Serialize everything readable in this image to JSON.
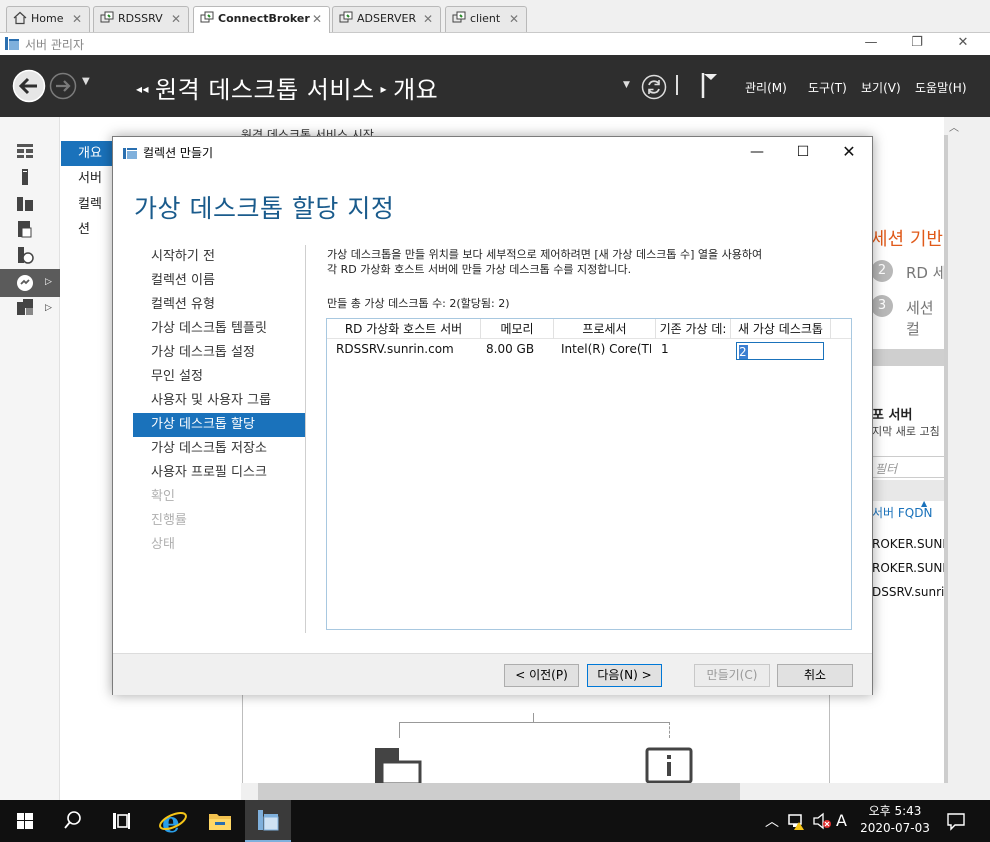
{
  "tabs": [
    {
      "label": "Home"
    },
    {
      "label": "RDSSRV"
    },
    {
      "label": "ConnectBroker"
    },
    {
      "label": "ADSERVER"
    },
    {
      "label": "client"
    }
  ],
  "server_manager": {
    "title": "서버 관리자",
    "breadcrumb": [
      "원격 데스크톱 서비스",
      "개요"
    ],
    "menus": [
      "관리(M)",
      "도구(T)",
      "보기(V)",
      "도움말(H)"
    ],
    "subnav": [
      "개요",
      "서버",
      "컬렉션"
    ],
    "content_peek": {
      "top_text": "원격 데스크톱 서비스 시작",
      "session_title": "세션 기반",
      "steps": [
        {
          "num": "2",
          "text": "RD 세"
        },
        {
          "num": "3",
          "text": "세션 컬"
        }
      ],
      "deploy_title": "포 서버",
      "deploy_sub": "지막 새로 고침",
      "filter_placeholder": "필터",
      "col_header": "서버 FQDN",
      "rows": [
        "ROKER.SUNRI",
        "ROKER.SUNRI",
        "DSSRV.sunrin."
      ]
    }
  },
  "dialog": {
    "title": "컬렉션 만들기",
    "heading": "가상 데스크톱 할당 지정",
    "steps": [
      {
        "label": "시작하기 전",
        "state": "normal"
      },
      {
        "label": "컬렉션 이름",
        "state": "normal"
      },
      {
        "label": "컬렉션 유형",
        "state": "normal"
      },
      {
        "label": "가상 데스크톱 템플릿",
        "state": "normal"
      },
      {
        "label": "가상 데스크톱 설정",
        "state": "normal"
      },
      {
        "label": "무인 설정",
        "state": "normal"
      },
      {
        "label": "사용자 및 사용자 그룹",
        "state": "normal"
      },
      {
        "label": "가상 데스크톱 할당",
        "state": "selected"
      },
      {
        "label": "가상 데스크톱 저장소",
        "state": "normal"
      },
      {
        "label": "사용자 프로필 디스크",
        "state": "normal"
      },
      {
        "label": "확인",
        "state": "disabled"
      },
      {
        "label": "진행률",
        "state": "disabled"
      },
      {
        "label": "상태",
        "state": "disabled"
      }
    ],
    "description_line1": "가상 데스크톱을 만들 위치를 보다 세부적으로 제어하려면 [새 가상 데스크톱 수] 열을 사용하여",
    "description_line2": "각 RD 가상화 호스트 서버에 만들 가상 데스크톱 수를 지정합니다.",
    "total_label": "만들 총 가상 데스크톱 수: 2(할당됨: 2)",
    "grid": {
      "headers": [
        "RD 가상화 호스트 서버",
        "메모리",
        "프로세서",
        "기존 가상 데:",
        "새 가상 데스크톱"
      ],
      "rows": [
        {
          "server": "RDSSRV.sunrin.com",
          "memory": "8.00 GB",
          "processor": "Intel(R) Core(TM",
          "existing": "1",
          "new": "2"
        }
      ]
    },
    "buttons": {
      "prev": "< 이전(P)",
      "next": "다음(N) >",
      "create": "만들기(C)",
      "cancel": "취소"
    }
  },
  "taskbar": {
    "time": "오후 5:43",
    "date": "2020-07-03",
    "ime": "A"
  }
}
